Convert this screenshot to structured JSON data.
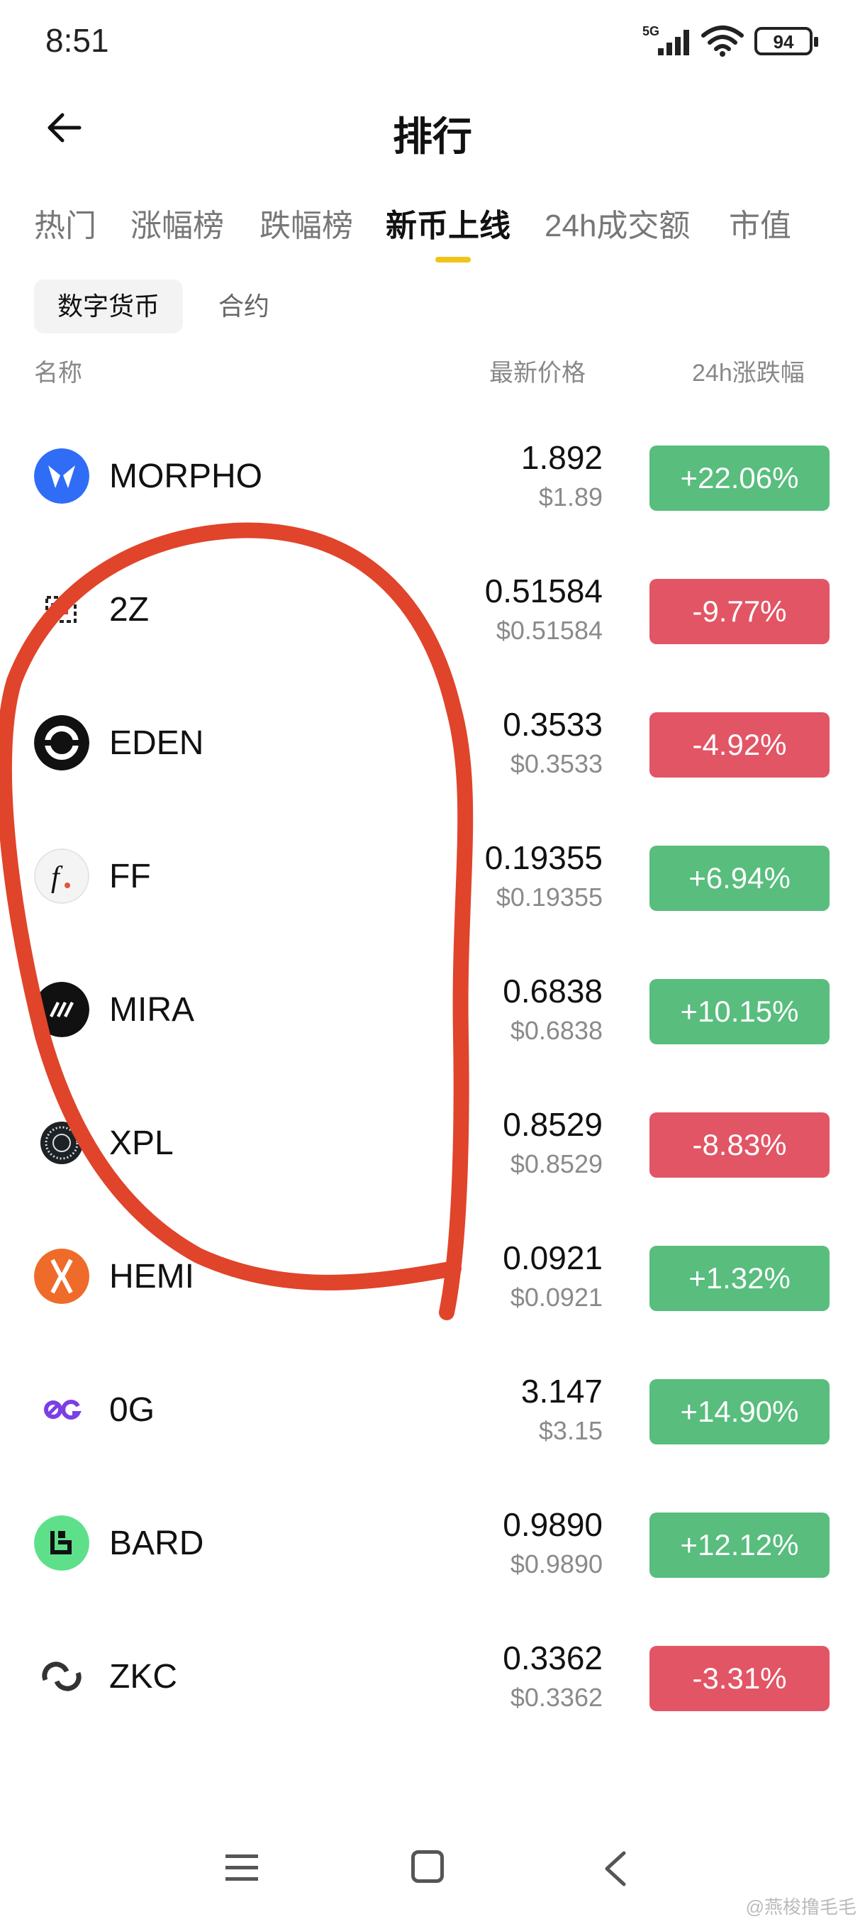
{
  "status_bar": {
    "time": "8:51",
    "network": "5G",
    "battery": "94"
  },
  "header": {
    "title": "排行"
  },
  "tabs": [
    {
      "label": "热门"
    },
    {
      "label": "涨幅榜"
    },
    {
      "label": "跌幅榜"
    },
    {
      "label": "新币上线",
      "active": true
    },
    {
      "label": "24h成交额"
    },
    {
      "label": "市值"
    }
  ],
  "subtabs": {
    "active": "数字货币",
    "inactive": "合约"
  },
  "columns": {
    "name": "名称",
    "price": "最新价格",
    "change": "24h涨跌幅"
  },
  "coins": [
    {
      "name": "MORPHO",
      "price": "1.892",
      "usd": "$1.89",
      "change": "+22.06%",
      "direction": "up",
      "icon": "morpho-logo"
    },
    {
      "name": "2Z",
      "price": "0.51584",
      "usd": "$0.51584",
      "change": "-9.77%",
      "direction": "down",
      "icon": "2z-logo"
    },
    {
      "name": "EDEN",
      "price": "0.3533",
      "usd": "$0.3533",
      "change": "-4.92%",
      "direction": "down",
      "icon": "eden-logo"
    },
    {
      "name": "FF",
      "price": "0.19355",
      "usd": "$0.19355",
      "change": "+6.94%",
      "direction": "up",
      "icon": "ff-logo"
    },
    {
      "name": "MIRA",
      "price": "0.6838",
      "usd": "$0.6838",
      "change": "+10.15%",
      "direction": "up",
      "icon": "mira-logo"
    },
    {
      "name": "XPL",
      "price": "0.8529",
      "usd": "$0.8529",
      "change": "-8.83%",
      "direction": "down",
      "icon": "xpl-logo"
    },
    {
      "name": "HEMI",
      "price": "0.0921",
      "usd": "$0.0921",
      "change": "+1.32%",
      "direction": "up",
      "icon": "hemi-logo"
    },
    {
      "name": "0G",
      "price": "3.147",
      "usd": "$3.15",
      "change": "+14.90%",
      "direction": "up",
      "icon": "0g-logo"
    },
    {
      "name": "BARD",
      "price": "0.9890",
      "usd": "$0.9890",
      "change": "+12.12%",
      "direction": "up",
      "icon": "bard-logo"
    },
    {
      "name": "ZKC",
      "price": "0.3362",
      "usd": "$0.3362",
      "change": "-3.31%",
      "direction": "down",
      "icon": "zkc-logo"
    }
  ],
  "colors": {
    "up": "#58bd7d",
    "down": "#e25565",
    "accent": "#f0c419",
    "annotation": "#e0442a"
  },
  "watermark": "@燕梭撸毛毛"
}
